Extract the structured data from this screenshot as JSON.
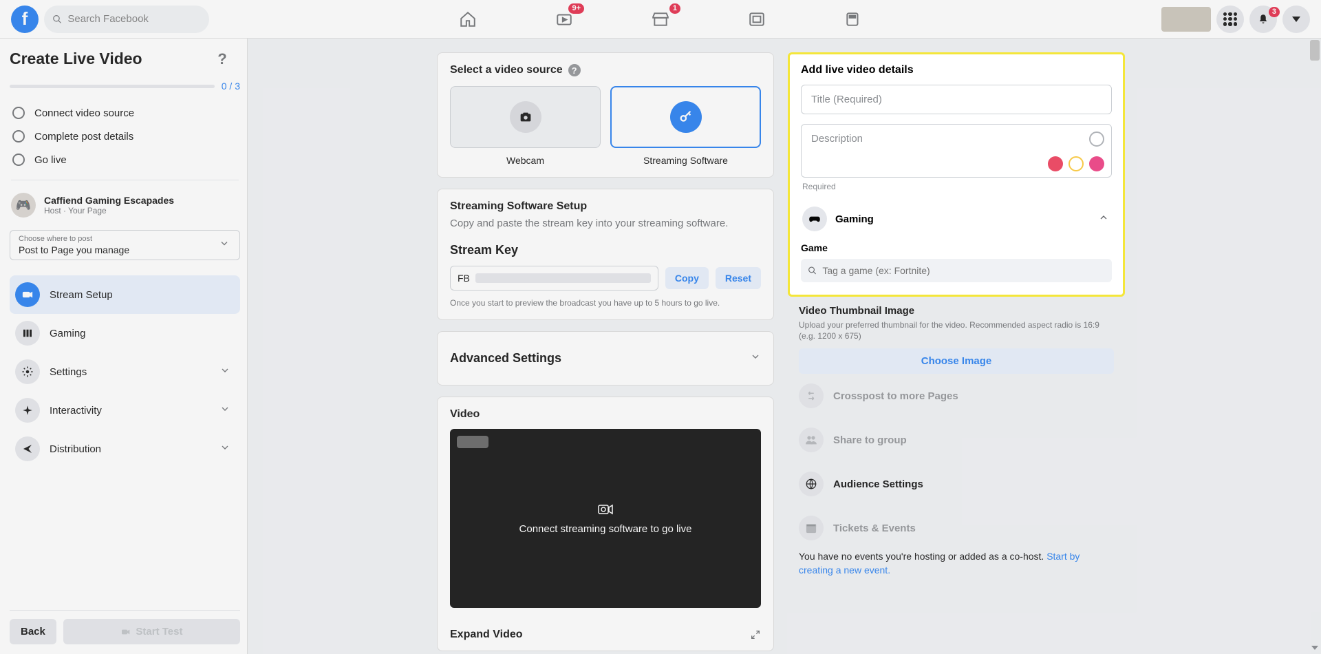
{
  "topbar": {
    "search_placeholder": "Search Facebook",
    "badges": {
      "watch": "9+",
      "market": "1",
      "notif": "3"
    }
  },
  "sidebar": {
    "title": "Create Live Video",
    "progress": "0 / 3",
    "steps": [
      "Connect video source",
      "Complete post details",
      "Go live"
    ],
    "host": {
      "name": "Caffiend Gaming Escapades",
      "sub": "Host · Your Page"
    },
    "post_to": {
      "lbl": "Choose where to post",
      "val": "Post to Page you manage"
    },
    "nav": {
      "stream": "Stream Setup",
      "gaming": "Gaming",
      "settings": "Settings",
      "interactivity": "Interactivity",
      "distribution": "Distribution"
    },
    "back": "Back",
    "start_test": "Start Test"
  },
  "source": {
    "heading": "Select a video source",
    "webcam": "Webcam",
    "software": "Streaming Software"
  },
  "setup": {
    "heading": "Streaming Software Setup",
    "desc": "Copy and paste the stream key into your streaming software.",
    "sk_title": "Stream Key",
    "sk_prefix": "FB",
    "copy": "Copy",
    "reset": "Reset",
    "note": "Once you start to preview the broadcast you have up to 5 hours to go live."
  },
  "advanced": "Advanced Settings",
  "video": {
    "heading": "Video",
    "msg": "Connect streaming software to go live",
    "expand": "Expand Video"
  },
  "details": {
    "heading": "Add live video details",
    "title_ph": "Title (Required)",
    "desc_ph": "Description",
    "required": "Required",
    "gaming": "Gaming",
    "game_lbl": "Game",
    "game_ph": "Tag a game (ex: Fortnite)"
  },
  "thumb": {
    "heading": "Video Thumbnail Image",
    "desc": "Upload your preferred thumbnail for the video. Recommended aspect radio is 16:9 (e.g. 1200 x 675)",
    "choose": "Choose Image"
  },
  "opts": {
    "crosspost": "Crosspost to more Pages",
    "share": "Share to group",
    "audience": "Audience Settings",
    "tickets": "Tickets & Events"
  },
  "events": {
    "note": "You have no events you're hosting or added as a co-host. ",
    "link": "Start by creating a new event."
  }
}
